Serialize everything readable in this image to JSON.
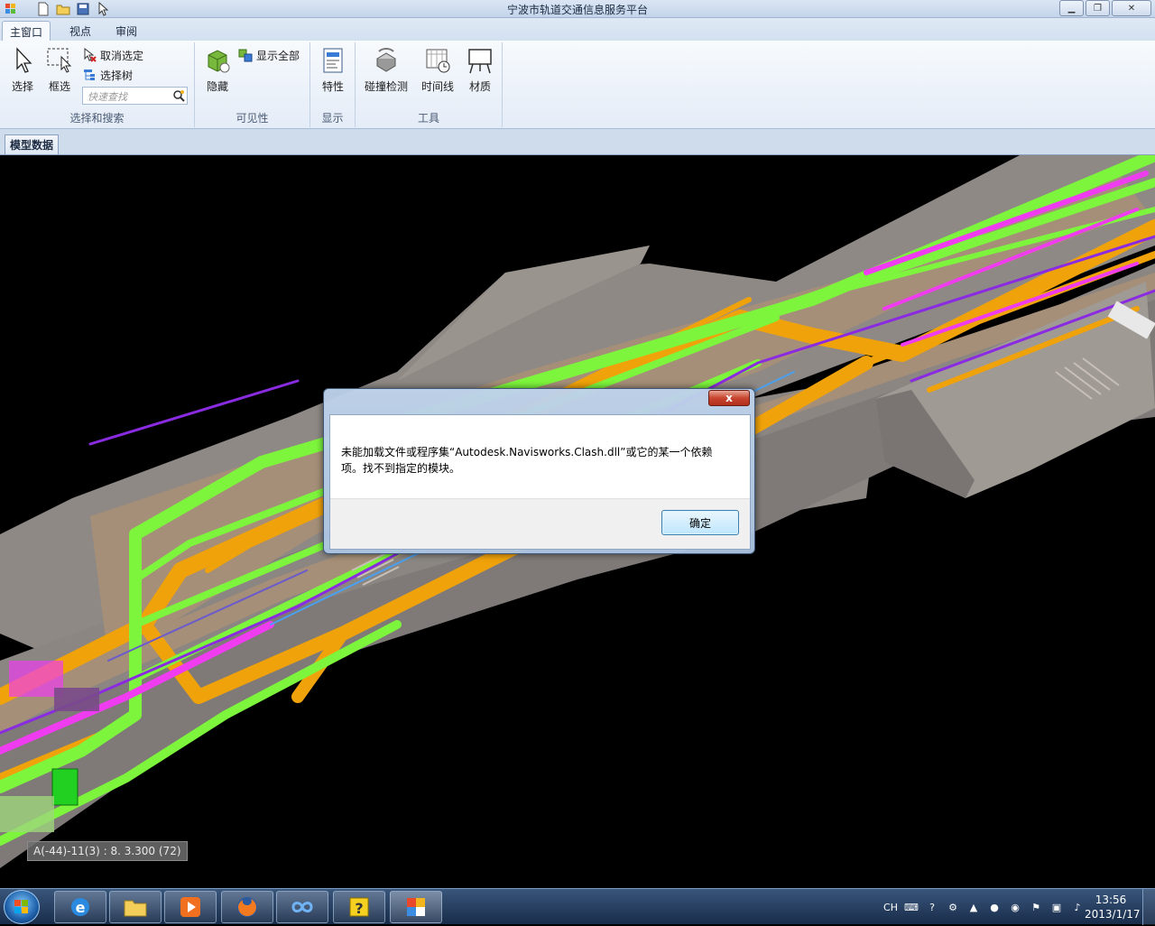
{
  "window": {
    "title": "宁波市轨道交通信息服务平台",
    "minimize_icon": "minimize-icon",
    "restore_icon": "restore-icon",
    "close_icon": "close-icon"
  },
  "tabs": [
    {
      "label": "主窗口",
      "active": true
    },
    {
      "label": "视点",
      "active": false
    },
    {
      "label": "审阅",
      "active": false
    }
  ],
  "ribbon": {
    "select_label": "选择",
    "box_select_label": "框选",
    "deselect_label": "取消选定",
    "select_tree_label": "选择树",
    "search_placeholder": "快速查找",
    "hide_label": "隐藏",
    "show_all_label": "显示全部",
    "properties_label": "特性",
    "clash_label": "碰撞检测",
    "timeline_label": "时间线",
    "material_label": "材质",
    "groups": {
      "select_search": "选择和搜索",
      "visibility": "可见性",
      "display": "显示",
      "tools": "工具"
    }
  },
  "doc_tab": "模型数据",
  "viewport": {
    "coordinate_readout": "A(-44)-11(3) : 8. 3.300 (72)"
  },
  "dialog": {
    "close_label": "x",
    "message": "未能加载文件或程序集“Autodesk.Navisworks.Clash.dll”或它的某一个依赖项。找不到指定的模块。",
    "ok_label": "确定"
  },
  "taskbar": {
    "tray_lang": "CH",
    "time": "13:56",
    "date": "2013/1/17"
  },
  "colors": {
    "pipe_orange": "#f0a20a",
    "pipe_green": "#7df53c",
    "pipe_magenta": "#f03cf0",
    "pipe_purple": "#8a2be2",
    "concrete": "#8f8985",
    "floor": "#a58f78"
  }
}
